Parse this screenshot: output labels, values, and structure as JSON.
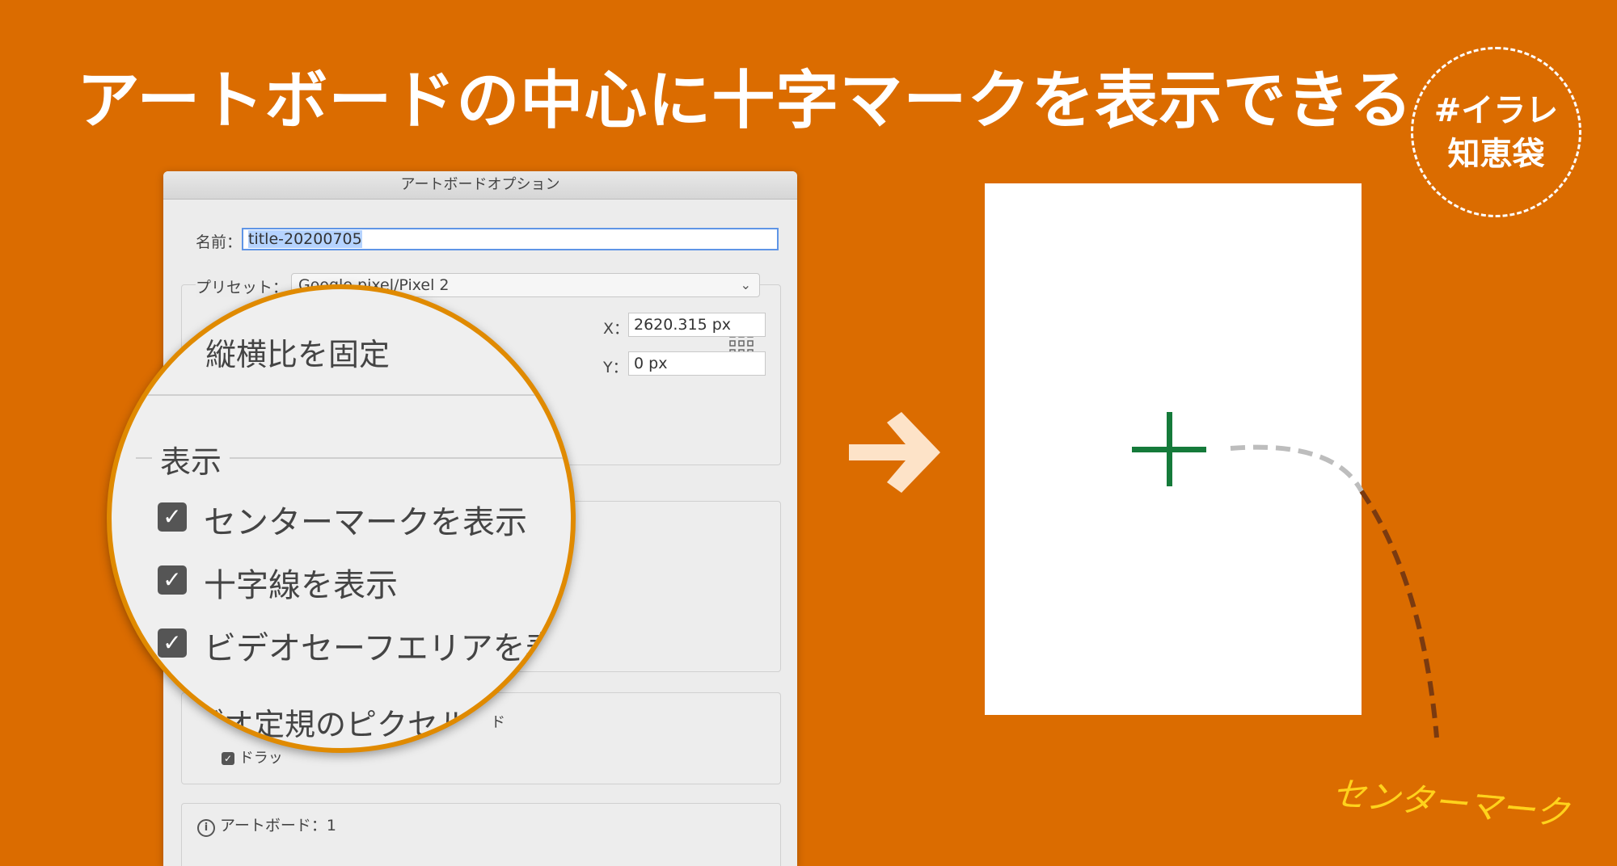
{
  "headline": "アートボードの中心に十字マークを表示できる",
  "badge": {
    "line1": "#イラレ",
    "line2": "知恵袋"
  },
  "dialog": {
    "title": "アートボードオプション",
    "name_label": "名前：",
    "name_value": "title-20200705",
    "preset_label": "プリセット：",
    "preset_value": "Google pixel/Pixel 2",
    "x_label": "X：",
    "x_value": "2620.315 px",
    "y_label": "Y：",
    "y_value": "0 px",
    "pixel_label_fragment": "ド",
    "drag_label_fragment": "ドラッ",
    "artboard_count": "アートボード：1"
  },
  "magnifier": {
    "aspect_lock": "縦横比を固定",
    "display_section": "表示",
    "options": [
      {
        "label": "センターマークを表示",
        "checked": true
      },
      {
        "label": "十字線を表示",
        "checked": true
      },
      {
        "label": "ビデオセーフエリアを表",
        "checked": true
      }
    ],
    "video_pixel": "デオ定規のピクセル"
  },
  "callout": "センターマーク",
  "colors": {
    "background": "#DB6C00",
    "center_mark": "#157a3a",
    "callout": "#ffd21c",
    "arrow": "#fde3c8"
  }
}
